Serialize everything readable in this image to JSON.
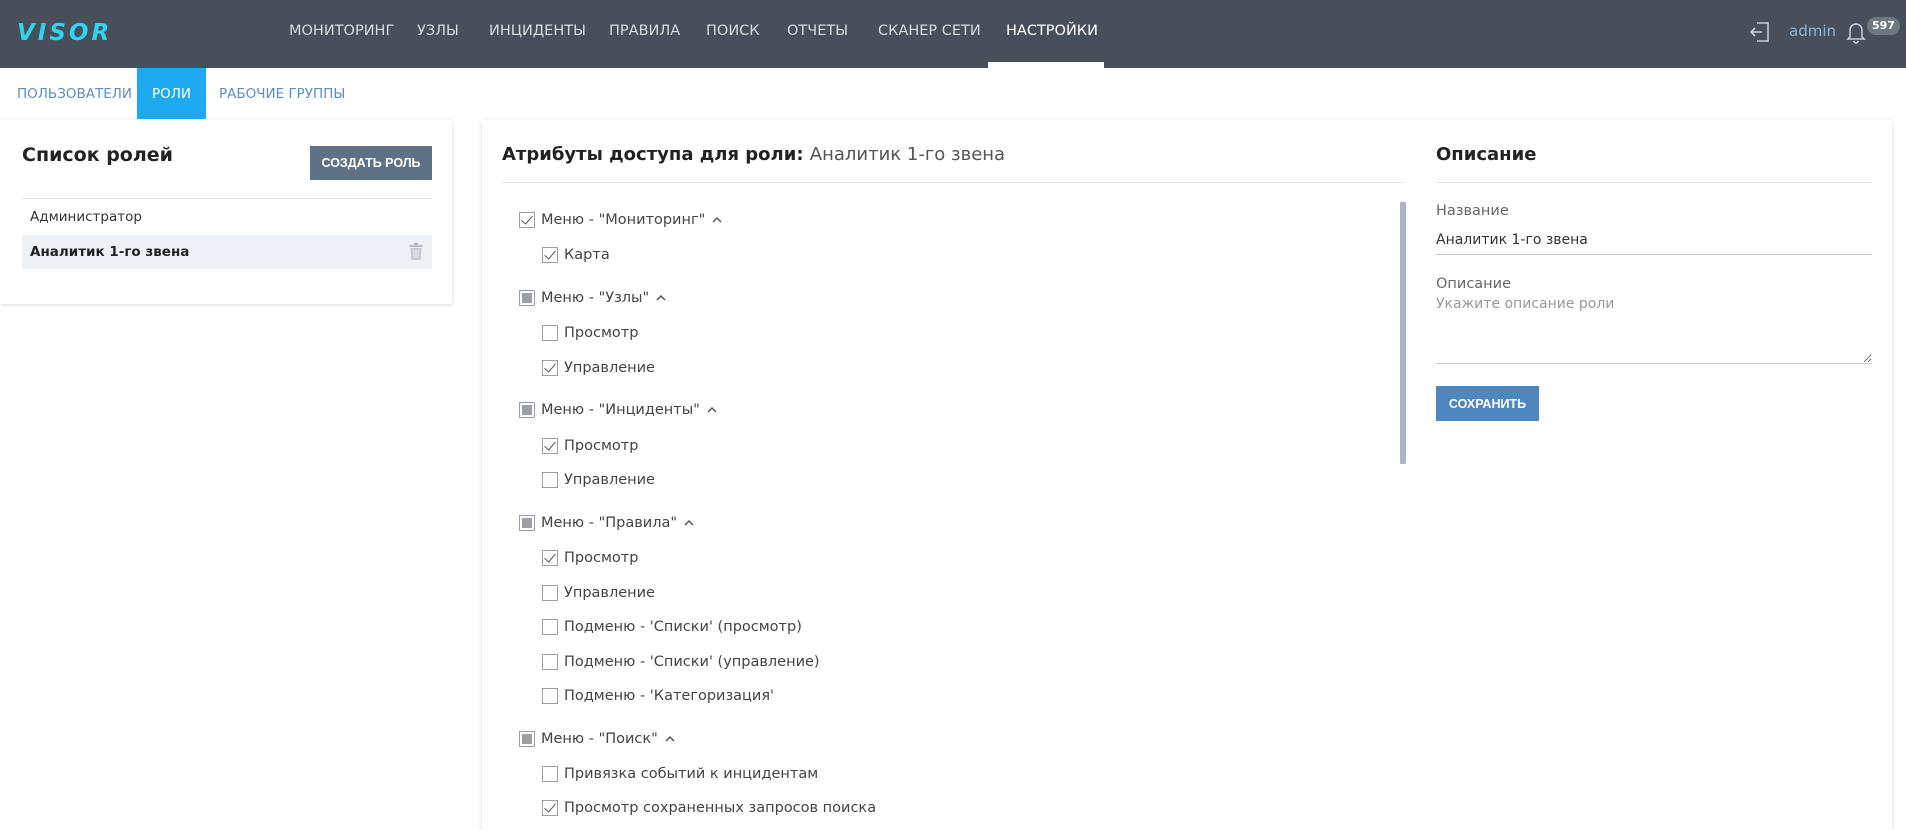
{
  "app": {
    "logo": "VISOR"
  },
  "topnav": {
    "items": [
      {
        "label": "МОНИТОРИНГ"
      },
      {
        "label": "УЗЛЫ"
      },
      {
        "label": "ИНЦИДЕНТЫ"
      },
      {
        "label": "ПРАВИЛА"
      },
      {
        "label": "ПОИСК"
      },
      {
        "label": "ОТЧЕТЫ"
      },
      {
        "label": "СКАНЕР СЕТИ"
      },
      {
        "label": "НАСТРОЙКИ",
        "active": true
      }
    ],
    "user": "admin",
    "notifications_count": "597"
  },
  "subtabs": {
    "items": [
      {
        "label": "ПОЛЬЗОВАТЕЛИ"
      },
      {
        "label": "РОЛИ",
        "active": true
      },
      {
        "label": "РАБОЧИЕ ГРУППЫ"
      }
    ]
  },
  "roles": {
    "title": "Список ролей",
    "create_button": "СОЗДАТЬ РОЛЬ",
    "items": [
      {
        "name": "Администратор"
      },
      {
        "name": "Аналитик 1-го звена",
        "selected": true
      }
    ]
  },
  "attributes": {
    "title_bold": "Атрибуты доступа для роли",
    "title_sep": ": ",
    "role_name": "Аналитик 1-го звена",
    "groups": [
      {
        "label": "Меню - \"Мониторинг\"",
        "state": "checked",
        "children": [
          {
            "label": "Карта",
            "checked": true
          }
        ]
      },
      {
        "label": "Меню - \"Узлы\"",
        "state": "indeterminate",
        "children": [
          {
            "label": "Просмотр",
            "checked": false
          },
          {
            "label": "Управление",
            "checked": true
          }
        ]
      },
      {
        "label": "Меню - \"Инциденты\"",
        "state": "indeterminate",
        "children": [
          {
            "label": "Просмотр",
            "checked": true
          },
          {
            "label": "Управление",
            "checked": false
          }
        ]
      },
      {
        "label": "Меню - \"Правила\"",
        "state": "indeterminate",
        "children": [
          {
            "label": "Просмотр",
            "checked": true
          },
          {
            "label": "Управление",
            "checked": false
          },
          {
            "label": "Подменю - 'Списки' (просмотр)",
            "checked": false
          },
          {
            "label": "Подменю - 'Списки' (управление)",
            "checked": false
          },
          {
            "label": "Подменю - 'Категоризация'",
            "checked": false
          }
        ]
      },
      {
        "label": "Меню - \"Поиск\"",
        "state": "indeterminate",
        "children": [
          {
            "label": "Привязка событий к инцидентам",
            "checked": false
          },
          {
            "label": "Просмотр сохраненных запросов поиска",
            "checked": true
          }
        ]
      }
    ]
  },
  "description": {
    "title": "Описание",
    "name_label": "Название",
    "name_value": "Аналитик 1-го звена",
    "desc_label": "Описание",
    "desc_placeholder": "Укажите описание роли",
    "save_button": "СОХРАНИТЬ"
  },
  "colors": {
    "topbar": "#474f5a",
    "logo": "#2fd4ef",
    "active_subtab": "#1eaaf1",
    "create_button": "#5d7187",
    "save_button": "#4e87be"
  }
}
